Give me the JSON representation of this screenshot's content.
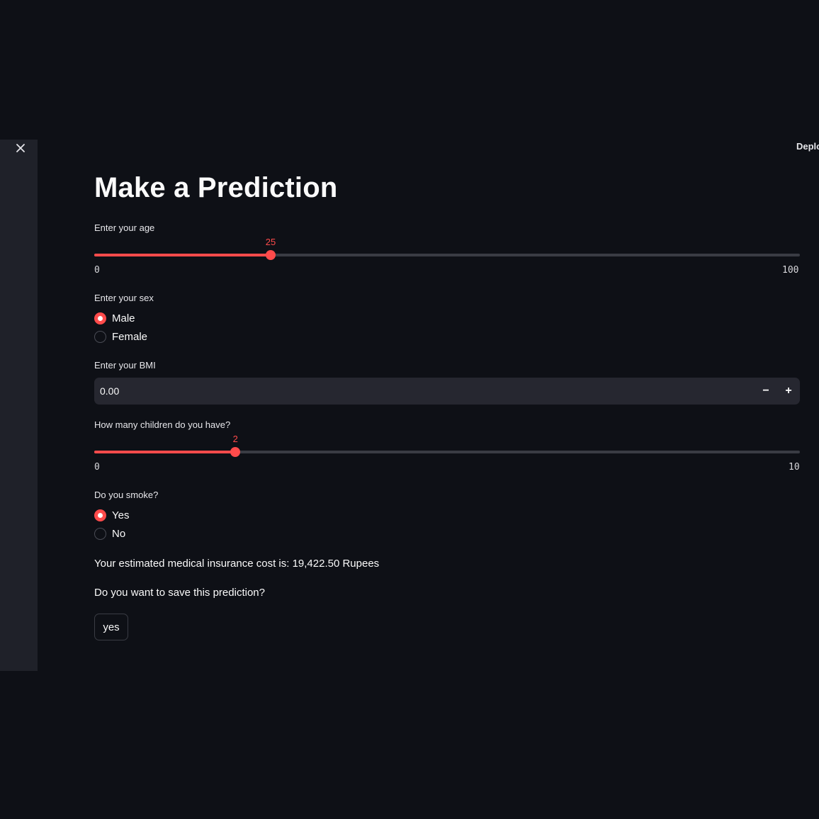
{
  "header": {
    "deploy_label": "Deplo"
  },
  "page": {
    "title": "Make a Prediction"
  },
  "age": {
    "label": "Enter your age",
    "value": 25,
    "min": 0,
    "max": 100,
    "min_label": "0",
    "max_label": "100",
    "value_label": "25"
  },
  "sex": {
    "label": "Enter your sex",
    "options": [
      "Male",
      "Female"
    ],
    "selected": "Male"
  },
  "bmi": {
    "label": "Enter your BMI",
    "value": "0.00",
    "minus": "−",
    "plus": "+"
  },
  "children": {
    "label": "How many children do you have?",
    "value": 2,
    "min": 0,
    "max": 10,
    "min_label": "0",
    "max_label": "10",
    "value_label": "2"
  },
  "smoke": {
    "label": "Do you smoke?",
    "options": [
      "Yes",
      "No"
    ],
    "selected": "Yes"
  },
  "result": {
    "text": "Your estimated medical insurance cost is: 19,422.50 Rupees"
  },
  "save": {
    "question": "Do you want to save this prediction?",
    "button_label": "yes"
  },
  "colors": {
    "accent": "#ff4b4b",
    "background": "#0e1016",
    "sidebar": "#1f2129",
    "input": "#262730"
  }
}
